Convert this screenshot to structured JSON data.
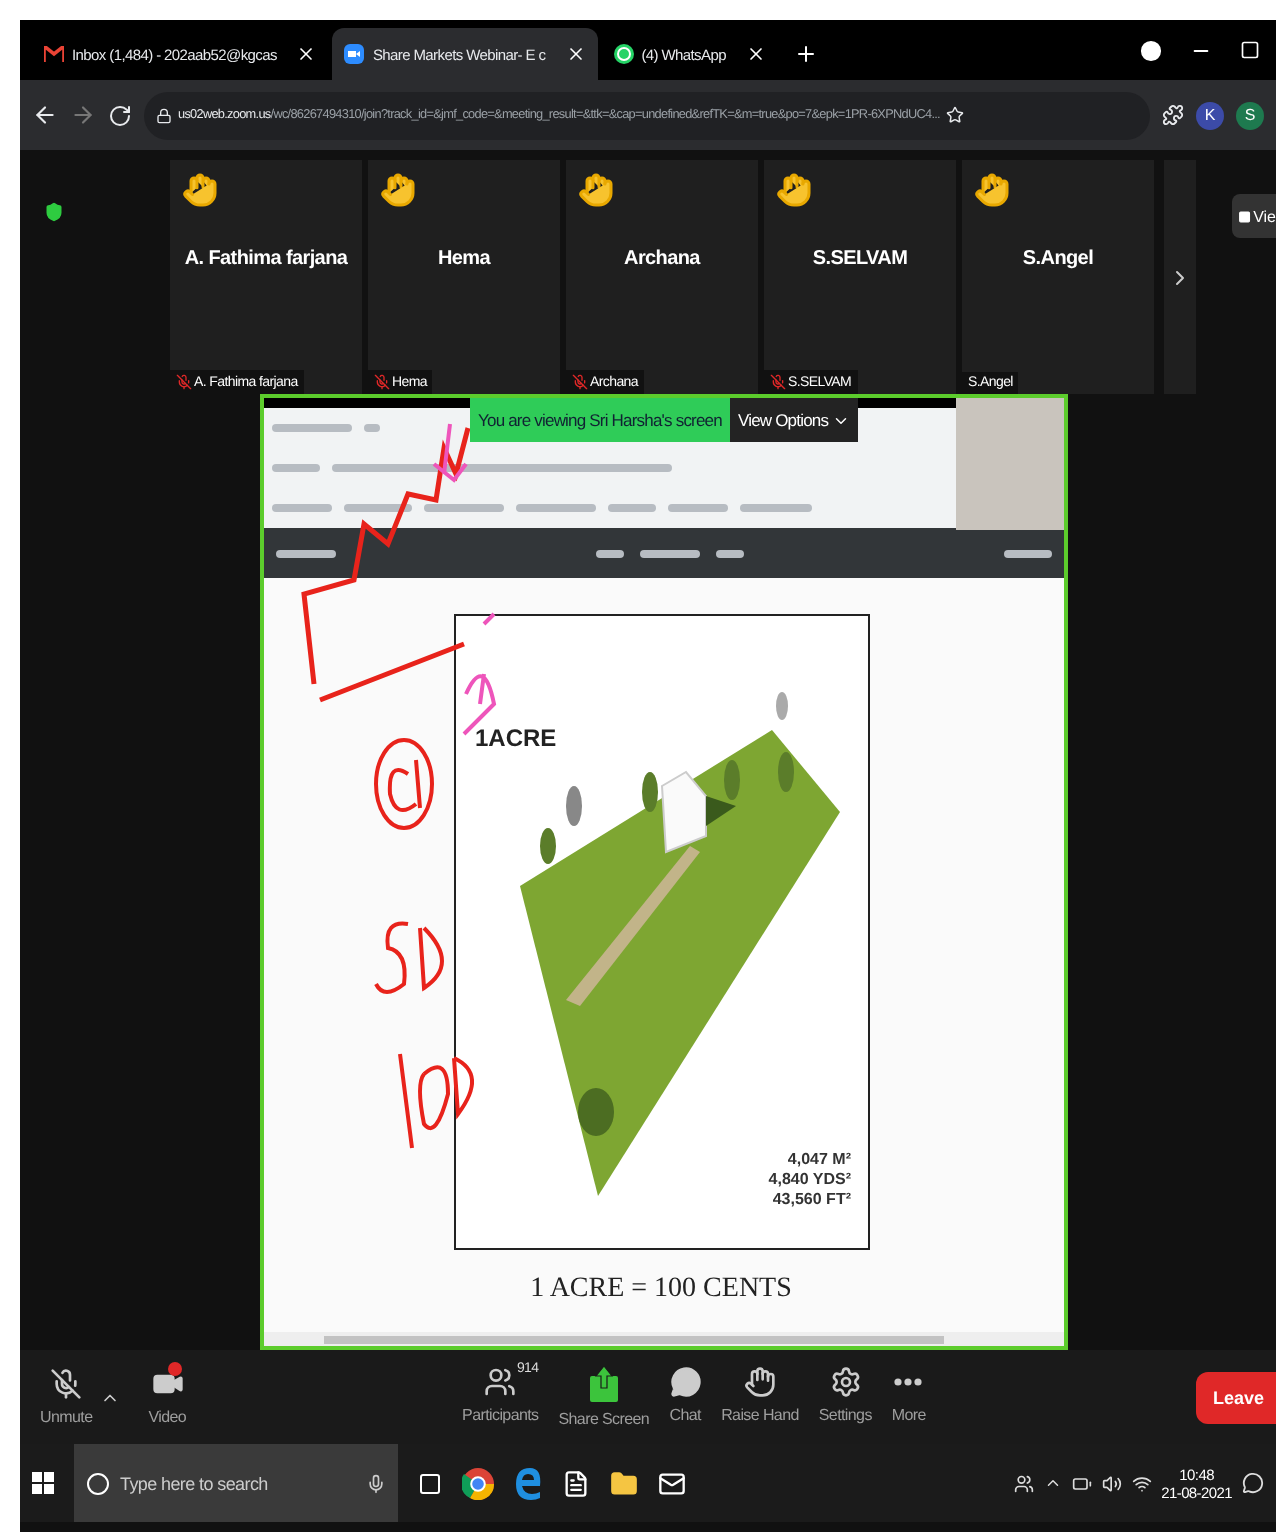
{
  "browser": {
    "tabs": [
      {
        "title": "Inbox (1,484) - 202aab52@kgcas",
        "selected": false,
        "kind": "mail"
      },
      {
        "title": "Share Markets Webinar- E c",
        "selected": true,
        "kind": "meeting"
      },
      {
        "title": "(4) WhatsApp",
        "selected": false,
        "kind": "chat"
      }
    ],
    "url_host": "us02web.zoom.us",
    "url_path": "/wc/86267494310/join?track_id=&jmf_code=&meeting_result=&ttk=&cap=undefined&refTK=&m=true&po=7&epk=1PR-6XPNdUC4...",
    "profile_initial": "K",
    "account_initial": "S"
  },
  "participants": [
    {
      "name": "A. Fathima farjana",
      "tag": "A. Fathima farjana",
      "muted": true,
      "hand_raised": true
    },
    {
      "name": "Hema",
      "tag": "Hema",
      "muted": true,
      "hand_raised": true
    },
    {
      "name": "Archana",
      "tag": "Archana",
      "muted": true,
      "hand_raised": true
    },
    {
      "name": "S.SELVAM",
      "tag": "S.SELVAM",
      "muted": true,
      "hand_raised": true
    },
    {
      "name": "S.Angel",
      "tag": "S.Angel",
      "muted": false,
      "hand_raised": true
    }
  ],
  "view_button": "Vie",
  "share": {
    "banner": "You are viewing Sri Harsha's screen",
    "view_options": "View Options",
    "slide": {
      "title": "1ACRE",
      "stats": [
        "4,047 M²",
        "4,840 YDS²",
        "43,560 FT²"
      ],
      "caption": "1 ACRE = 100 CENTS"
    }
  },
  "toolbar": {
    "items": [
      {
        "kind": "unmute",
        "label": "Unmute"
      },
      {
        "kind": "video",
        "label": "Video"
      },
      {
        "kind": "participants",
        "label": "Participants",
        "count": "914"
      },
      {
        "kind": "share",
        "label": "Share Screen"
      },
      {
        "kind": "chat",
        "label": "Chat"
      },
      {
        "kind": "hand",
        "label": "Raise Hand"
      },
      {
        "kind": "settings",
        "label": "Settings"
      },
      {
        "kind": "more",
        "label": "More"
      }
    ],
    "leave": "Leave"
  },
  "taskbar": {
    "search_placeholder": "Type here to search",
    "time": "10:48",
    "date": "21-08-2021"
  }
}
